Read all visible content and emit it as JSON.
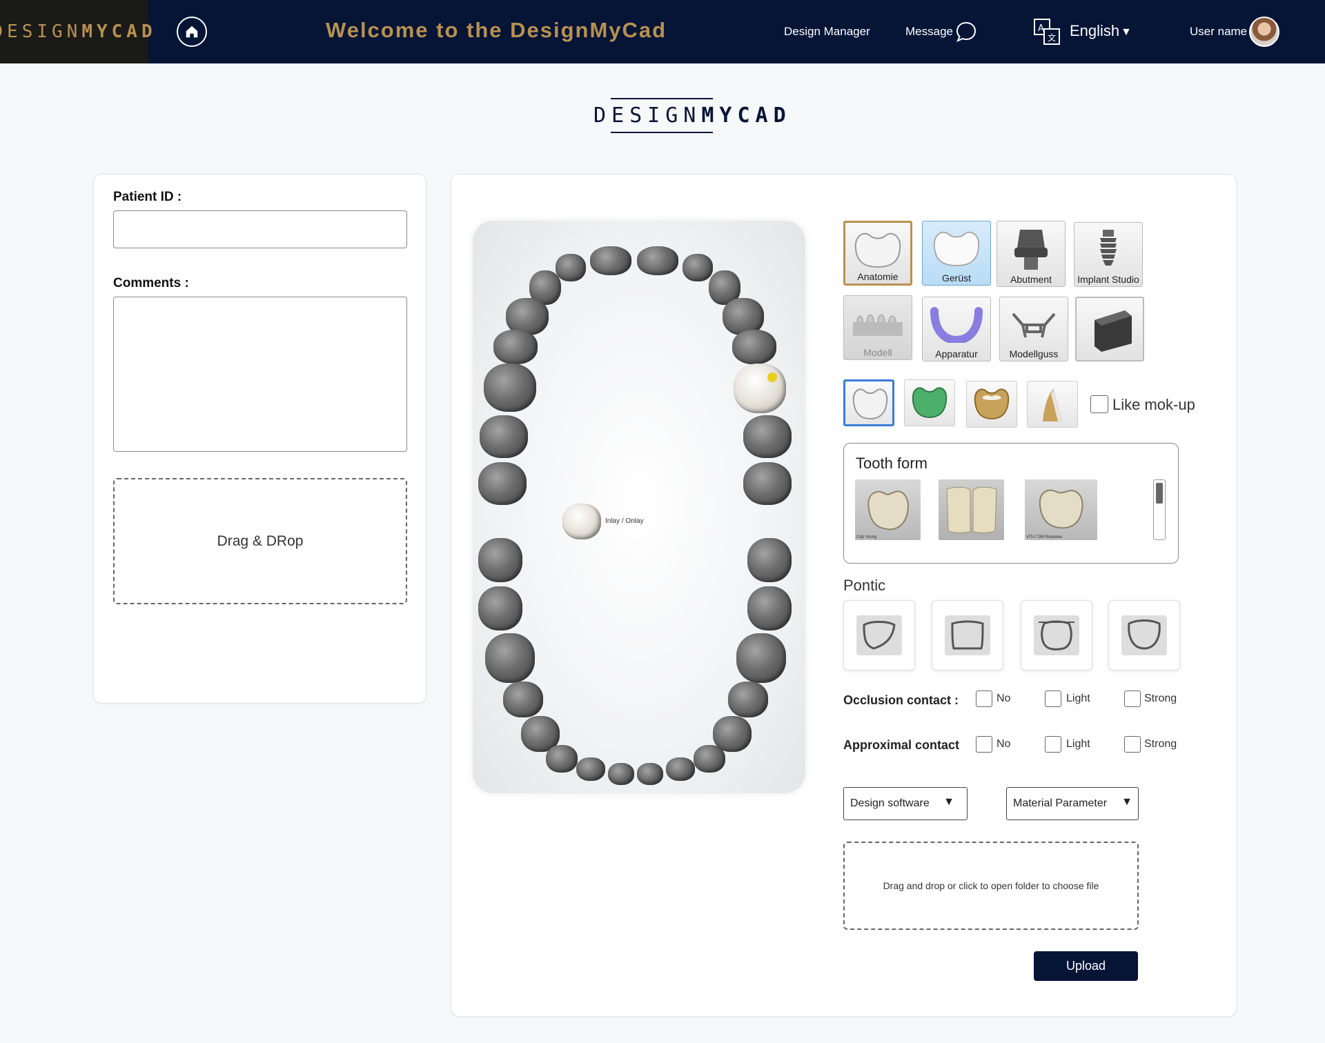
{
  "header": {
    "logo_thin": "DESIGN",
    "logo_bold": "MYCAD",
    "welcome": "Welcome to the DesignMyCad",
    "design_manager": "Design Manager",
    "message": "Message",
    "language": "English",
    "user_name": "User name",
    "accent_color": "#b89150",
    "bg_color": "#061436"
  },
  "brand": {
    "thin": "DESIGN",
    "bold": "MYCAD"
  },
  "left_panel": {
    "patient_id_label": "Patient ID :",
    "comments_label": "Comments :",
    "drag_drop": "Drag & DRop"
  },
  "jaw": {
    "inlay_label": "Inlay / Onlay"
  },
  "restoration_types": [
    {
      "label": "Anatomie"
    },
    {
      "label": "Gerüst"
    },
    {
      "label": "Abutment"
    },
    {
      "label": "Implant Studio"
    },
    {
      "label": "Modell"
    },
    {
      "label": "Apparatur"
    },
    {
      "label": "Modellguss"
    }
  ],
  "mokup_label": "Like mok-up",
  "tooth_form": {
    "title": "Tooth form",
    "thumbs": [
      {
        "caption": "Cdp Young"
      },
      {
        "caption": ""
      },
      {
        "caption": "VITA T3M Realview"
      }
    ]
  },
  "pontic_label": "Pontic",
  "occlusion": {
    "label": "Occlusion contact :",
    "options": [
      "No",
      "Light",
      "Strong"
    ]
  },
  "approximal": {
    "label": "Approximal contact",
    "options": [
      "No",
      "Light",
      "Strong"
    ]
  },
  "design_software": "Design software",
  "material_parameter": "Material Parameter",
  "upload_zone": "Drag and drop or click to open folder to choose file",
  "upload_button": "Upload"
}
